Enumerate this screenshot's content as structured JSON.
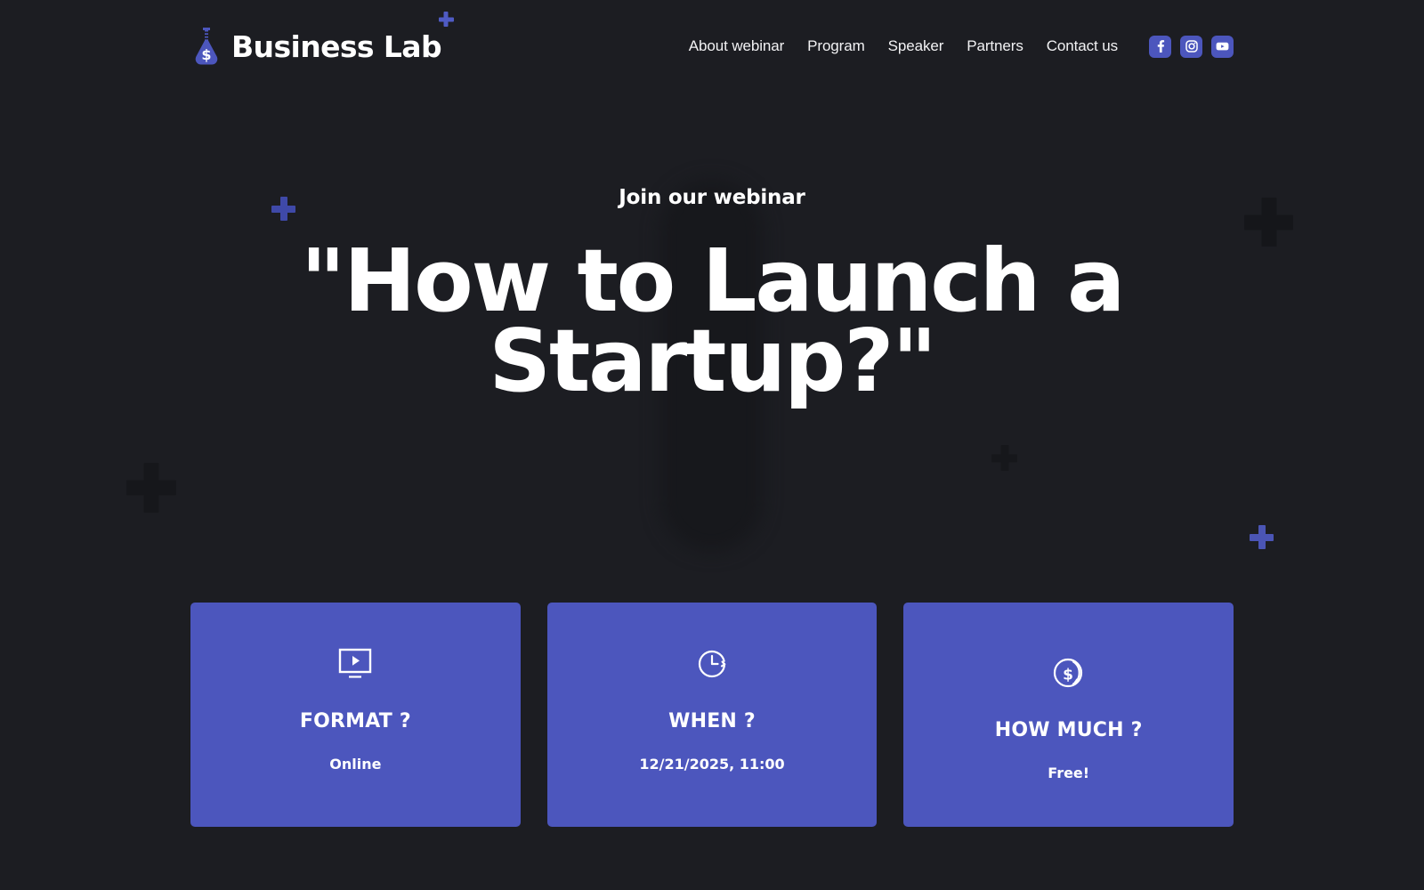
{
  "brand": {
    "name": "Business Lab",
    "logo_icon": "flask-dollar-icon",
    "logo_color": "#4c56bd",
    "accent_plus_color": "#4f5bc4"
  },
  "nav": {
    "items": [
      {
        "label": "About webinar",
        "name": "nav-about-webinar"
      },
      {
        "label": "Program",
        "name": "nav-program"
      },
      {
        "label": "Speaker",
        "name": "nav-speaker"
      },
      {
        "label": "Partners",
        "name": "nav-partners"
      },
      {
        "label": "Contact us",
        "name": "nav-contact-us"
      }
    ],
    "socials": [
      {
        "icon": "facebook-icon",
        "name": "social-facebook"
      },
      {
        "icon": "instagram-icon",
        "name": "social-instagram"
      },
      {
        "icon": "youtube-icon",
        "name": "social-youtube"
      }
    ]
  },
  "hero": {
    "kicker": "Join our webinar",
    "title": "\"How to Launch a Startup?\""
  },
  "cards": [
    {
      "icon": "monitor-play-icon",
      "title": "FORMAT ?",
      "value": "Online",
      "name": "card-format"
    },
    {
      "icon": "clock-icon",
      "title": "WHEN ?",
      "value": "12/21/2025, 11:00",
      "name": "card-when"
    },
    {
      "icon": "coin-dollar-icon",
      "title": "HOW MUCH ?",
      "value": "Free!",
      "name": "card-how-much"
    }
  ],
  "theme": {
    "background": "#1c1d22",
    "card_background": "#4c56bd",
    "text": "#ffffff",
    "blob": "#17181c",
    "dark_plus": "#17181b"
  }
}
